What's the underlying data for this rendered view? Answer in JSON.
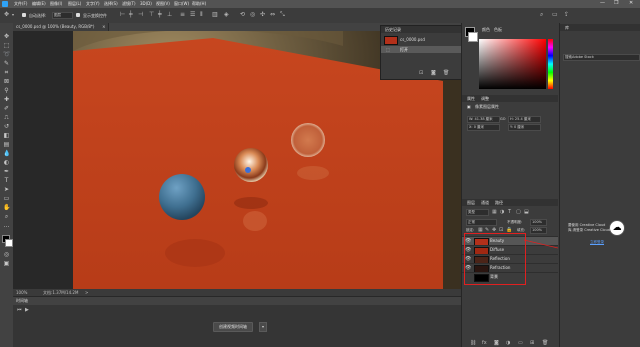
{
  "app": {
    "menu": [
      "文件(F)",
      "编辑(E)",
      "图像(I)",
      "图层(L)",
      "文字(Y)",
      "选择(S)",
      "滤镜(T)",
      "3D(D)",
      "视图(V)",
      "窗口(W)",
      "帮助(H)"
    ],
    "window_controls": [
      "—",
      "❐",
      "✕"
    ]
  },
  "options_bar": {
    "auto_select_label": "自动选择:",
    "auto_select_value": "图层",
    "show_transform_label": "显示变换控件"
  },
  "document": {
    "tab_title": "cs_0000.psd @ 100% (Beauty, RGB/8*)",
    "tab_close": "×",
    "zoom": "100%",
    "doc_info": "文档:1.37M/14.2M",
    "status_arrow": ">"
  },
  "timeline": {
    "title": "时间轴",
    "create_button": "创建视频时间轴",
    "dropdown": "▾"
  },
  "history": {
    "title": "历史记录",
    "snapshot_name": "cs_0000.psd",
    "state_label": "打开"
  },
  "color_panel": {
    "tabs": [
      "颜色",
      "色板"
    ],
    "foreground": "#000000",
    "background": "#ffffff"
  },
  "properties": {
    "tabs": [
      "属性",
      "调整"
    ],
    "subtitle": "像素图层属性",
    "w": "W: 41.38 厘米",
    "go": "GO",
    "h": "H: 25.4 厘米",
    "x": "X: 0 厘米",
    "y": "Y: 0 厘米"
  },
  "layers_panel": {
    "tabs": [
      "图层",
      "通道",
      "路径"
    ],
    "filter": "类型",
    "blend_mode": "正常",
    "opacity_label": "不透明度:",
    "opacity_value": "100%",
    "lock_label": "锁定:",
    "fill_label": "填充:",
    "fill_value": "100%",
    "layers": [
      {
        "name": "Beauty",
        "visible": true,
        "selected": true,
        "color": "#b3301a"
      },
      {
        "name": "Diffuse",
        "visible": true,
        "selected": false,
        "color": "#a02812"
      },
      {
        "name": "Reflection",
        "visible": true,
        "selected": false,
        "color": "#4b2418"
      },
      {
        "name": "Refraction",
        "visible": true,
        "selected": false,
        "color": "#2a1510"
      }
    ],
    "background_layer": "背景"
  },
  "far_right": {
    "libraries_title": "库",
    "search_label": "搜索Adobe Stock",
    "cloud_line1": "要使用 Creative Cloud",
    "cloud_line2": "库,请登录 Creative Cloud",
    "login_link": "立即登录"
  },
  "colors": {
    "canvas_orange": "#c8481f",
    "highlight_red": "#e02020"
  }
}
